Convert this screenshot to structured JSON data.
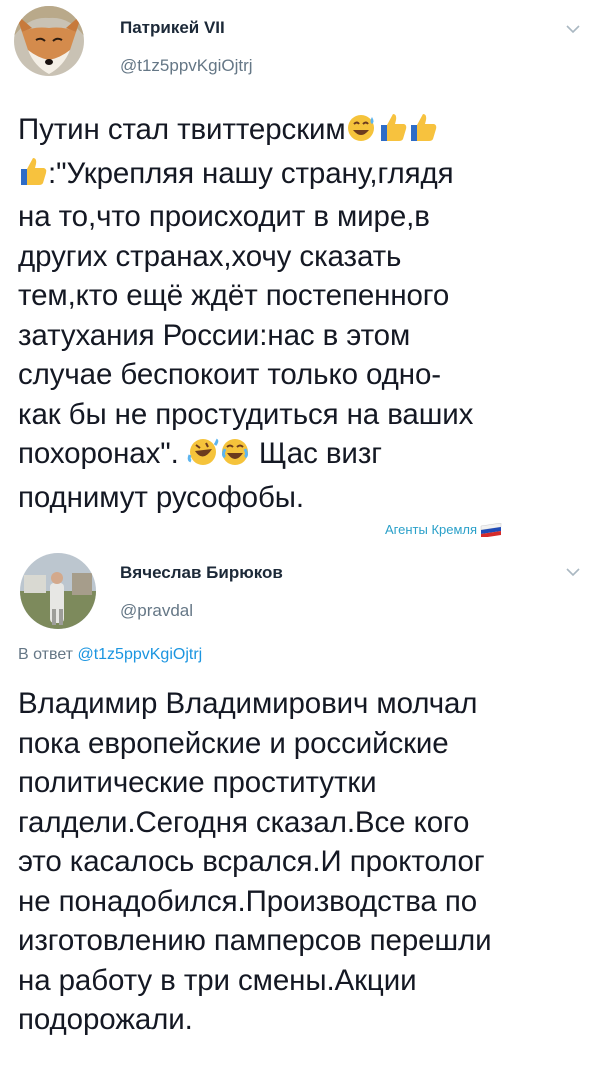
{
  "tweet1": {
    "author_name": "Патрикей VII",
    "author_handle": "@t1z5ppvKgiOjtrj",
    "lines": [
      "Путин стал твиттерским",
      ":\"Укрепляя нашу страну,глядя",
      "на то,что происходит в мире,в",
      "других странах,хочу сказать",
      "тем,кто ещё ждёт постепенного",
      "затухания России:нас в этом",
      "случае беспокоит только одно-",
      "как бы не простудиться на ваших",
      "похоронах\".",
      " Щас визг",
      "поднимут русофобы."
    ]
  },
  "watermark": "Агенты Кремля",
  "tweet2": {
    "author_name": "Вячеслав Бирюков",
    "author_handle": "@pravdal",
    "reply_prefix": "В ответ",
    "reply_handle": "@t1z5ppvKgiOjtrj",
    "lines": [
      "Владимир Владимирович молчал",
      "пока европейские и российские",
      "политические проститутки",
      "галдели.Сегодня сказал.Все кого",
      "это касалось всрался.И проктолог",
      "не понадобился.Производства по",
      "изготовлению памперсов перешли",
      "на работу в три смены.Акции",
      "подорожали."
    ]
  },
  "icons": [
    "fox-avatar-icon",
    "chevron-down-icon",
    "sweat-smile-emoji-icon",
    "thumbs-up-emoji-icon",
    "rofl-emoji-icon",
    "joy-emoji-icon",
    "russia-flag-icon",
    "user-photo-avatar-icon"
  ],
  "colors": {
    "text": "#141823",
    "secondary": "#657786",
    "link": "#1b95e0",
    "watermark": "#2aa0c9"
  }
}
